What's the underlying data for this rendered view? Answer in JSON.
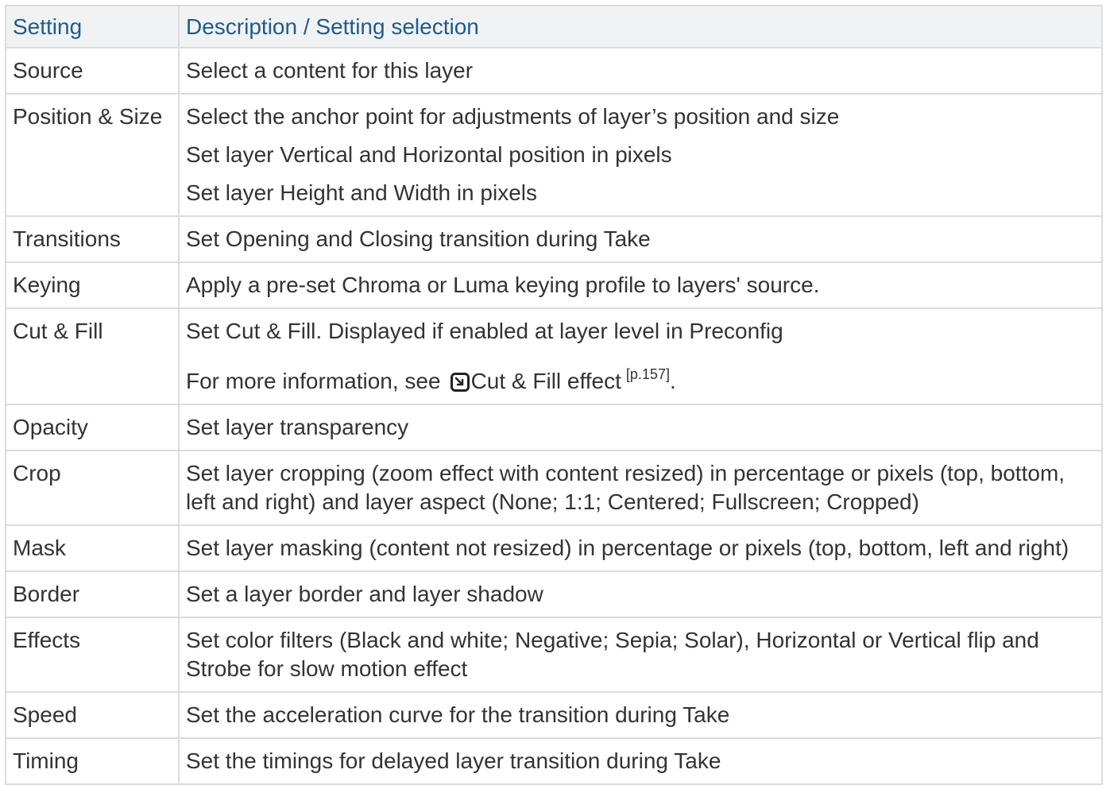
{
  "header": {
    "col1": "Setting",
    "col2": "Description / Setting selection"
  },
  "rows": {
    "source": {
      "name": "Source",
      "desc": [
        "Select a content for this layer"
      ]
    },
    "position": {
      "name": "Position & Size",
      "desc": [
        "Select the anchor point for adjustments of layer’s position and size",
        "Set layer Vertical and Horizontal position in pixels",
        "Set layer Height and Width in pixels"
      ]
    },
    "transitions": {
      "name": "Transitions",
      "desc": [
        "Set Opening and Closing transition during Take"
      ]
    },
    "keying": {
      "name": "Keying",
      "desc": [
        "Apply a pre-set Chroma or Luma keying profile to layers' source."
      ]
    },
    "cutfill": {
      "name": "Cut & Fill",
      "desc": [
        "Set Cut & Fill. Displayed if enabled at layer level in Preconfig"
      ],
      "more_prefix": "For more information, see",
      "link_text": "Cut & Fill effect",
      "page_ref": "[p.157]",
      "suffix": "."
    },
    "opacity": {
      "name": "Opacity",
      "desc": [
        "Set layer transparency"
      ]
    },
    "crop": {
      "name": "Crop",
      "desc": [
        "Set layer cropping (zoom effect with content resized) in percentage or pixels (top, bottom, left and right) and layer aspect (None; 1:1; Centered; Fullscreen; Cropped)"
      ]
    },
    "mask": {
      "name": "Mask",
      "desc": [
        "Set layer masking (content not resized) in percentage or pixels (top, bottom, left and right)"
      ]
    },
    "border": {
      "name": "Border",
      "desc": [
        "Set a layer border and layer shadow"
      ]
    },
    "effects": {
      "name": "Effects",
      "desc": [
        "Set color filters (Black and white; Negative; Sepia; Solar), Horizontal or Vertical flip and Strobe for slow motion effect"
      ]
    },
    "speed": {
      "name": "Speed",
      "desc": [
        "Set the acceleration curve for the transition during Take"
      ]
    },
    "timing": {
      "name": "Timing",
      "desc": [
        "Set the timings for delayed layer transition during Take"
      ]
    }
  }
}
